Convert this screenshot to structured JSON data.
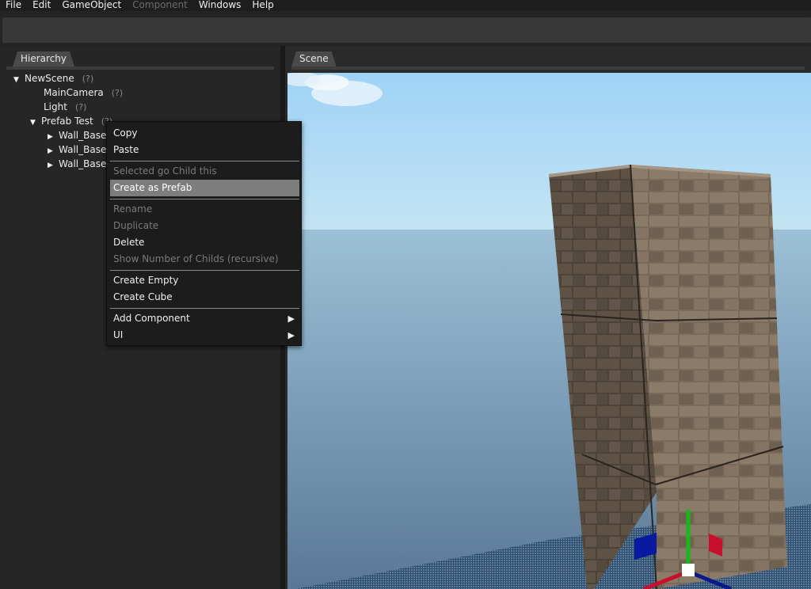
{
  "menubar": {
    "items": [
      {
        "label": "File",
        "enabled": true
      },
      {
        "label": "Edit",
        "enabled": true
      },
      {
        "label": "GameObject",
        "enabled": true
      },
      {
        "label": "Component",
        "enabled": false
      },
      {
        "label": "Windows",
        "enabled": true
      },
      {
        "label": "Help",
        "enabled": true
      }
    ]
  },
  "hierarchy": {
    "tab_label": "Hierarchy",
    "help_marker": "(?)",
    "tree": {
      "root": "NewScene",
      "main_camera": "MainCamera",
      "light": "Light",
      "prefab": "Prefab Test",
      "children": [
        "Wall_Base",
        "Wall_Base",
        "Wall_Base"
      ]
    }
  },
  "scene": {
    "tab_label": "Scene"
  },
  "context_menu": {
    "copy": "Copy",
    "paste": "Paste",
    "selected_go_child": "Selected go Child this",
    "create_prefab": "Create as Prefab",
    "rename": "Rename",
    "duplicate": "Duplicate",
    "delete": "Delete",
    "show_childs": "Show Number of Childs (recursive)",
    "create_empty": "Create Empty",
    "create_cube": "Create Cube",
    "add_component": "Add Component",
    "ui": "UI",
    "submenu_arrow": "▶"
  },
  "colors": {
    "highlight": "#7d7d7d",
    "gizmo_x": "#c8102e",
    "gizmo_y": "#18b818",
    "gizmo_z": "#0a1a8a"
  }
}
